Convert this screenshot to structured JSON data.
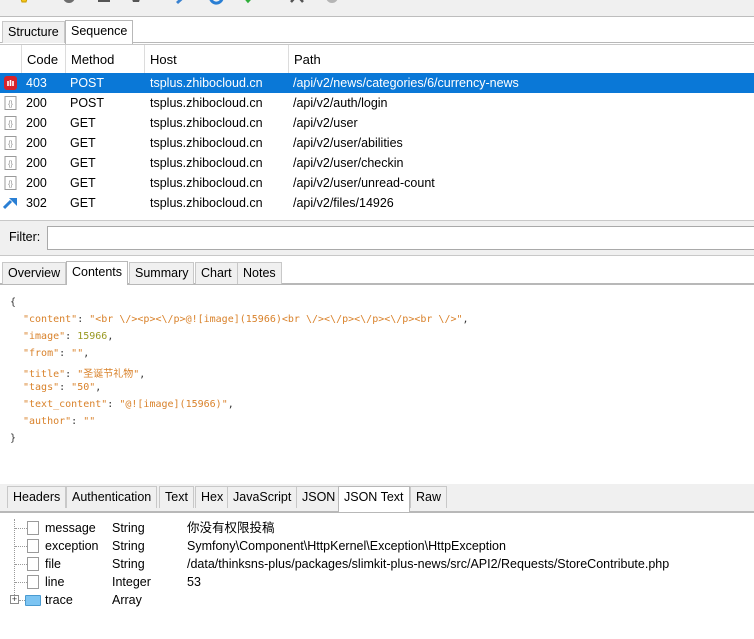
{
  "toolbar": {
    "icons": [
      "lightbulb-icon",
      "record-icon",
      "printer-icon",
      "trash-icon",
      "pen-icon",
      "refresh-icon",
      "checkmark-icon",
      "tools-icon",
      "gear-icon"
    ]
  },
  "top_tabs": [
    {
      "label": "Structure",
      "active": false
    },
    {
      "label": "Sequence",
      "active": true
    }
  ],
  "sequence": {
    "columns": {
      "code": "Code",
      "method": "Method",
      "host": "Host",
      "path": "Path"
    },
    "rows": [
      {
        "icon": "blocked-icon",
        "code": "403",
        "method": "POST",
        "host": "tsplus.zhibocloud.cn",
        "path": "/api/v2/news/categories/6/currency-news",
        "selected": true
      },
      {
        "icon": "json-doc-icon",
        "code": "200",
        "method": "POST",
        "host": "tsplus.zhibocloud.cn",
        "path": "/api/v2/auth/login",
        "selected": false
      },
      {
        "icon": "json-doc-icon",
        "code": "200",
        "method": "GET",
        "host": "tsplus.zhibocloud.cn",
        "path": "/api/v2/user",
        "selected": false
      },
      {
        "icon": "json-doc-icon",
        "code": "200",
        "method": "GET",
        "host": "tsplus.zhibocloud.cn",
        "path": "/api/v2/user/abilities",
        "selected": false
      },
      {
        "icon": "json-doc-icon",
        "code": "200",
        "method": "GET",
        "host": "tsplus.zhibocloud.cn",
        "path": "/api/v2/user/checkin",
        "selected": false
      },
      {
        "icon": "json-doc-icon",
        "code": "200",
        "method": "GET",
        "host": "tsplus.zhibocloud.cn",
        "path": "/api/v2/user/unread-count",
        "selected": false
      },
      {
        "icon": "redirect-icon",
        "code": "302",
        "method": "GET",
        "host": "tsplus.zhibocloud.cn",
        "path": "/api/v2/files/14926",
        "selected": false
      }
    ]
  },
  "filter": {
    "label": "Filter:",
    "value": ""
  },
  "detail_tabs": [
    {
      "label": "Overview",
      "active": false
    },
    {
      "label": "Contents",
      "active": true
    },
    {
      "label": "Summary",
      "active": false
    },
    {
      "label": "Chart",
      "active": false
    },
    {
      "label": "Notes",
      "active": false
    }
  ],
  "contents": {
    "open_brace": "{",
    "close_brace": "}",
    "lines": [
      {
        "key": "\"content\"",
        "value": "\"<br \\/><p><\\/p>@![image](15966)<br \\/><\\/p><\\/p><\\/p><br \\/>\"",
        "value_type": "string",
        "trail": ","
      },
      {
        "key": "\"image\"",
        "value": "15966",
        "value_type": "number",
        "trail": ","
      },
      {
        "key": "\"from\"",
        "value": "\"\"",
        "value_type": "string",
        "trail": ","
      },
      {
        "key": "\"title\"",
        "value": "\"圣诞节礼物\"",
        "value_type": "string",
        "trail": ","
      },
      {
        "key": "\"tags\"",
        "value": "\"50\"",
        "value_type": "string",
        "trail": ","
      },
      {
        "key": "\"text_content\"",
        "value": "\"@![image](15966)\"",
        "value_type": "string",
        "trail": ","
      },
      {
        "key": "\"author\"",
        "value": "\"\"",
        "value_type": "string",
        "trail": ""
      }
    ]
  },
  "viewer_tabs": [
    {
      "label": "Headers",
      "active": false
    },
    {
      "label": "Authentication",
      "active": false
    },
    {
      "label": "Text",
      "active": false
    },
    {
      "label": "Hex",
      "active": false
    },
    {
      "label": "JavaScript",
      "active": false
    },
    {
      "label": "JSON",
      "active": false
    },
    {
      "label": "JSON Text",
      "active": true
    },
    {
      "label": "Raw",
      "active": false
    }
  ],
  "json_tree": [
    {
      "name": "message",
      "type": "String",
      "value": "你没有权限投稿",
      "icon": "document-icon",
      "expandable": false
    },
    {
      "name": "exception",
      "type": "String",
      "value": "Symfony\\Component\\HttpKernel\\Exception\\HttpException",
      "icon": "document-icon",
      "expandable": false
    },
    {
      "name": "file",
      "type": "String",
      "value": "/data/thinksns-plus/packages/slimkit-plus-news/src/API2/Requests/StoreContribute.php",
      "icon": "document-icon",
      "expandable": false
    },
    {
      "name": "line",
      "type": "Integer",
      "value": "53",
      "icon": "document-icon",
      "expandable": false
    },
    {
      "name": "trace",
      "type": "Array",
      "value": "",
      "icon": "folder-icon",
      "expandable": true,
      "expander": "+"
    }
  ],
  "colors": {
    "selection": "#0a78d7",
    "json_string": "#d9822b",
    "json_number": "#999922"
  }
}
